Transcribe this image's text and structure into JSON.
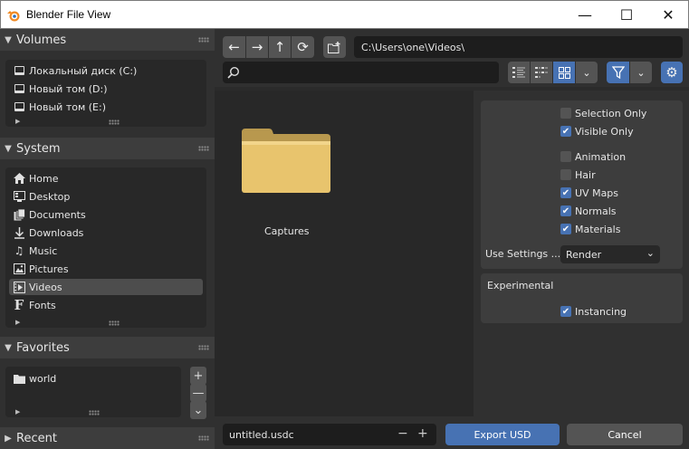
{
  "window": {
    "title": "Blender File View",
    "minimize": "—",
    "maximize": "☐",
    "close": "✕"
  },
  "sidebar": {
    "volumes": {
      "title": "Volumes",
      "items": [
        "Локальный диск (C:)",
        "Новый том (D:)",
        "Новый том (E:)"
      ]
    },
    "system": {
      "title": "System",
      "items": [
        "Home",
        "Desktop",
        "Documents",
        "Downloads",
        "Music",
        "Pictures",
        "Videos",
        "Fonts"
      ],
      "selected": "Videos"
    },
    "favorites": {
      "title": "Favorites",
      "items": [
        "world"
      ],
      "add": "+",
      "remove": "—",
      "more": "⌄"
    },
    "recent": {
      "title": "Recent"
    }
  },
  "toolbar": {
    "path": "C:\\Users\\one\\Videos\\",
    "search_value": "",
    "display_mode": "thumbnails"
  },
  "files": [
    {
      "name": "Captures",
      "type": "folder"
    }
  ],
  "options": {
    "checkboxes": [
      {
        "label": "Selection Only",
        "checked": false
      },
      {
        "label": "Visible Only",
        "checked": true
      },
      {
        "label": "Animation",
        "checked": false
      },
      {
        "label": "Hair",
        "checked": false
      },
      {
        "label": "UV Maps",
        "checked": true
      },
      {
        "label": "Normals",
        "checked": true
      },
      {
        "label": "Materials",
        "checked": true
      }
    ],
    "use_settings_label": "Use Settings ...",
    "use_settings_value": "Render",
    "experimental_title": "Experimental",
    "instancing": {
      "label": "Instancing",
      "checked": true
    }
  },
  "footer": {
    "filename": "untitled.usdc",
    "decrement": "−",
    "increment": "+",
    "export_label": "Export USD",
    "cancel_label": "Cancel"
  },
  "colors": {
    "accent": "#4772b3",
    "folder": "#e8c46d",
    "panel": "#303030"
  }
}
